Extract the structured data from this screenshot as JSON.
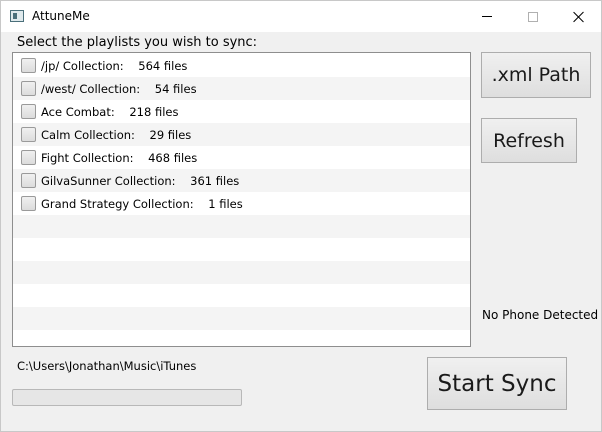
{
  "window": {
    "title": "AttuneMe"
  },
  "prompt": "Select the playlists you wish to sync:",
  "playlists": [
    {
      "label": "/jp/ Collection:    564 files",
      "checked": false
    },
    {
      "label": "/west/ Collection:    54 files",
      "checked": false
    },
    {
      "label": "Ace Combat:    218 files",
      "checked": false
    },
    {
      "label": "Calm Collection:    29 files",
      "checked": false
    },
    {
      "label": "Fight Collection:    468 files",
      "checked": false
    },
    {
      "label": "GilvaSunner Collection:    361 files",
      "checked": false
    },
    {
      "label": "Grand Strategy Collection:    1 files",
      "checked": false
    }
  ],
  "buttons": {
    "xml_path": ".xml Path",
    "refresh": "Refresh",
    "start_sync": "Start Sync"
  },
  "phone_status": "No Phone Detected",
  "library_path": "C:\\Users\\Jonathan\\Music\\iTunes",
  "progress": 0,
  "colors": {
    "progress_fill": "#06b025",
    "row_alt": "#f4f4f4",
    "window_bg": "#f0f0f0"
  },
  "icons": {
    "app": "app-window-icon",
    "minimize": "minimize-icon",
    "maximize": "maximize-icon",
    "close": "close-icon"
  }
}
